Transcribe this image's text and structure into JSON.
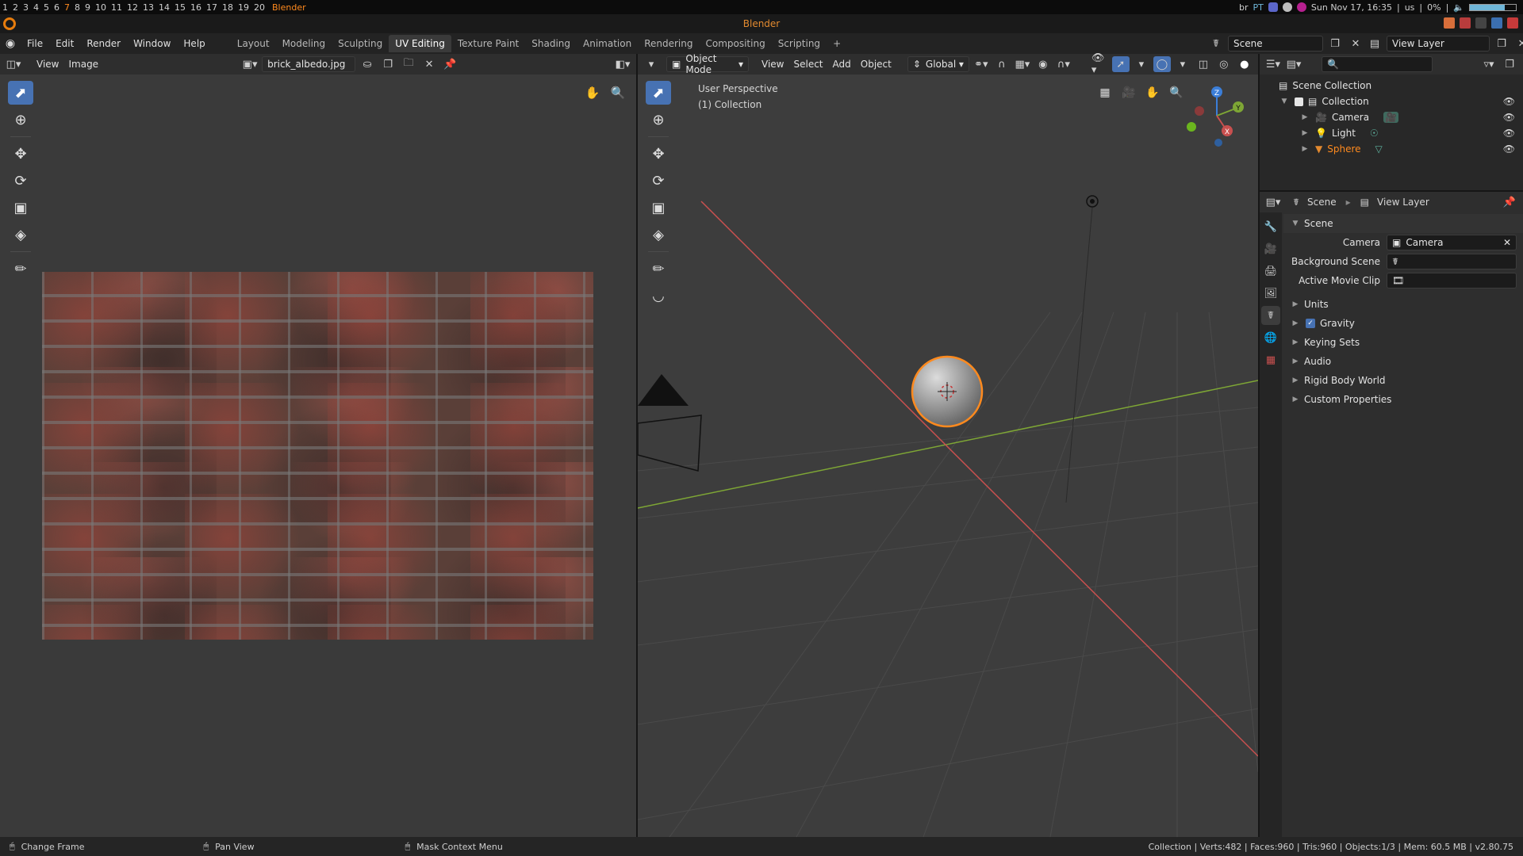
{
  "system_bar": {
    "workspaces": [
      "1",
      "2",
      "3",
      "4",
      "5",
      "6",
      "7",
      "8",
      "9",
      "10",
      "11",
      "12",
      "13",
      "14",
      "15",
      "16",
      "17",
      "18",
      "19",
      "20"
    ],
    "active_workspace": "7",
    "app_name": "Blender",
    "layout_code": "br",
    "pt_label": "PT",
    "datetime": "Sun Nov 17, 16:35",
    "keyboard": "us",
    "volume": "0%",
    "battery_level": 0.75
  },
  "window": {
    "title": "Blender"
  },
  "menus": [
    "File",
    "Edit",
    "Render",
    "Window",
    "Help"
  ],
  "workspace_tabs": [
    "Layout",
    "Modeling",
    "Sculpting",
    "UV Editing",
    "Texture Paint",
    "Shading",
    "Animation",
    "Rendering",
    "Compositing",
    "Scripting"
  ],
  "active_tab": "UV Editing",
  "add_tab_label": "+",
  "scene_field": "Scene",
  "view_layer_field": "View Layer",
  "image_editor": {
    "menus": [
      "View",
      "Image"
    ],
    "image_name": "brick_albedo.jpg"
  },
  "viewport": {
    "mode": "Object Mode",
    "menus": [
      "View",
      "Select",
      "Add",
      "Object"
    ],
    "orientation": "Global",
    "overlay_title": "User Perspective",
    "overlay_collection": "(1) Collection",
    "gizmo": {
      "z": "Z",
      "y": "Y",
      "x": "X"
    }
  },
  "outliner": {
    "search_placeholder": "",
    "items": [
      {
        "label": "Scene Collection"
      },
      {
        "label": "Collection"
      },
      {
        "label": "Camera"
      },
      {
        "label": "Light"
      },
      {
        "label": "Sphere"
      }
    ]
  },
  "properties": {
    "header_scene": "Scene",
    "header_view_layer": "View Layer",
    "panel_title": "Scene",
    "camera_label": "Camera",
    "camera_value": "Camera",
    "background_scene_label": "Background Scene",
    "active_movie_clip_label": "Active Movie Clip",
    "subpanels": [
      "Units",
      "Gravity",
      "Keying Sets",
      "Audio",
      "Rigid Body World",
      "Custom Properties"
    ]
  },
  "status_bar": {
    "change_frame": "Change Frame",
    "pan_view": "Pan View",
    "mask_context_menu": "Mask Context Menu",
    "stats": "Collection | Verts:482 | Faces:960 | Tris:960 | Objects:1/3 | Mem: 60.5 MB | v2.80.75"
  },
  "colors": {
    "accent": "#4772b3",
    "selected_orange": "#ff8a1e",
    "x_axis": "#c8504f",
    "y_axis": "#7ea635",
    "z_axis": "#3b7ed8"
  }
}
